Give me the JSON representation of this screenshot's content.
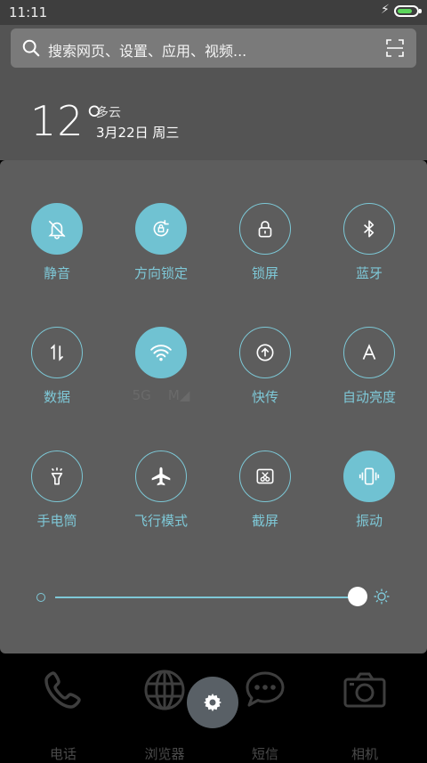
{
  "status_bar": {
    "time": "11:11",
    "battery_level": 0.8
  },
  "search": {
    "placeholder": "搜索网页、设置、应用、视频..."
  },
  "weather": {
    "temperature": "12°",
    "condition": "多云",
    "date": "3月22日 周三"
  },
  "tiles": [
    {
      "label": "静音",
      "icon": "bell-off-icon",
      "active": true
    },
    {
      "label": "方向锁定",
      "icon": "rotation-lock-icon",
      "active": true
    },
    {
      "label": "锁屏",
      "icon": "lock-icon",
      "active": false
    },
    {
      "label": "蓝牙",
      "icon": "bluetooth-icon",
      "active": false
    },
    {
      "label": "数据",
      "icon": "data-arrows-icon",
      "active": false
    },
    {
      "label": "5G    M◢",
      "icon": "wifi-icon",
      "active": true
    },
    {
      "label": "快传",
      "icon": "upload-icon",
      "active": false
    },
    {
      "label": "自动亮度",
      "icon": "auto-brightness-icon",
      "active": false
    },
    {
      "label": "手电筒",
      "icon": "flashlight-icon",
      "active": false
    },
    {
      "label": "飞行模式",
      "icon": "airplane-icon",
      "active": false
    },
    {
      "label": "截屏",
      "icon": "screenshot-icon",
      "active": false
    },
    {
      "label": "振动",
      "icon": "vibrate-icon",
      "active": true
    }
  ],
  "brightness": {
    "level": 1.0
  },
  "dock": [
    {
      "label": "电话",
      "icon": "phone-icon"
    },
    {
      "label": "浏览器",
      "icon": "globe-icon"
    },
    {
      "label": "短信",
      "icon": "message-icon"
    },
    {
      "label": "相机",
      "icon": "camera-icon"
    }
  ],
  "colors": {
    "accent": "#7ec8d7",
    "active_fill": "#70c2d2",
    "panel": "#5d5d5d"
  }
}
